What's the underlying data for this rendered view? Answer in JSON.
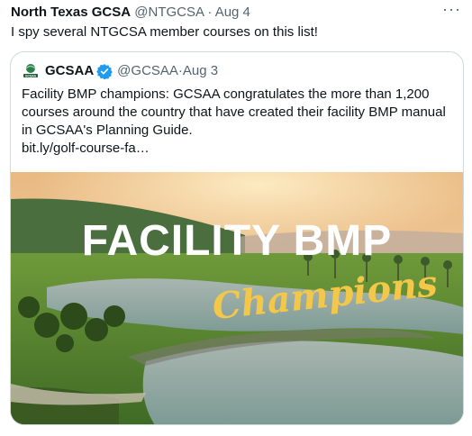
{
  "tweet": {
    "name": "North Texas GCSA",
    "handle": "@NTGCSA",
    "sep": " · ",
    "date": "Aug 4",
    "more": "···",
    "text": "I spy several NTGCSA member courses on this list!"
  },
  "quote": {
    "logo_text": "GCSAA",
    "name": "GCSAA",
    "handle": "@GCSAA",
    "sep": " · ",
    "date": "Aug 3",
    "body": "Facility BMP champions: GCSAA congratulates the more than 1,200 courses around the country that have created their facility BMP manual in GCSAA's Planning Guide.",
    "link": "bit.ly/golf-course-fa…",
    "verified_color": "#1d9bf0"
  },
  "media": {
    "title_line1": "FACILITY BMP",
    "title_line2": "Champions",
    "title_color": "#ffffff",
    "script_color": "#f3c74a"
  }
}
